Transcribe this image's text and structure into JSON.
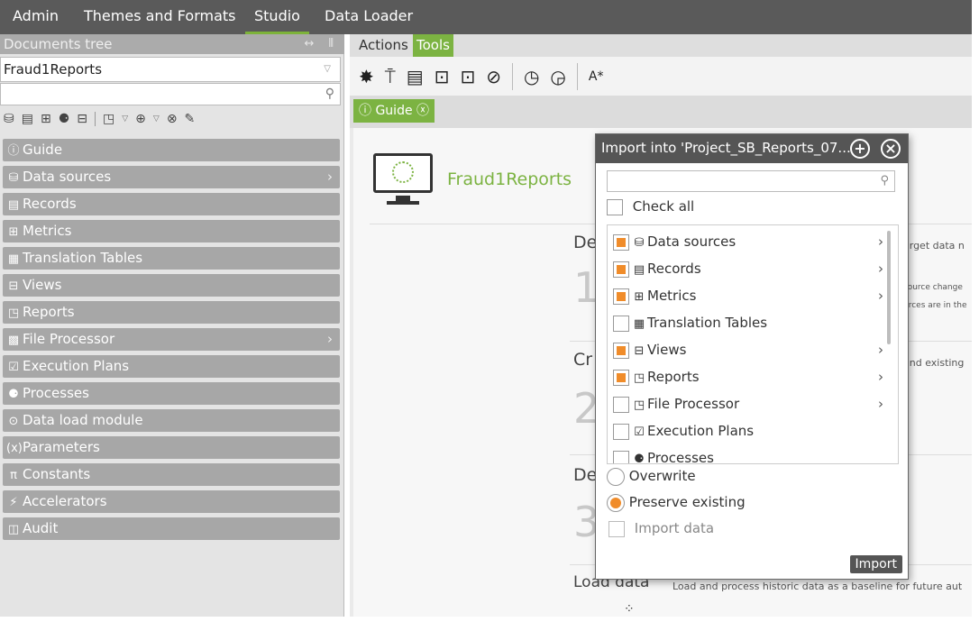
{
  "topbar": {
    "tabs": [
      "Admin",
      "Themes and Formats",
      "Studio",
      "Data Loader"
    ],
    "active": "Studio"
  },
  "left_panel": {
    "title": "Documents tree",
    "title_controls": "↔ ⫴",
    "document_select": "Fraud1Reports",
    "tree_items": [
      {
        "label": "Guide",
        "icon": "info-icon",
        "glyph": "ⓘ"
      },
      {
        "label": "Data sources",
        "icon": "database-icon",
        "glyph": "⛁",
        "has_children": true
      },
      {
        "label": "Records",
        "icon": "records-icon",
        "glyph": "▤"
      },
      {
        "label": "Metrics",
        "icon": "metrics-icon",
        "glyph": "⊞"
      },
      {
        "label": "Translation Tables",
        "icon": "table-icon",
        "glyph": "▦"
      },
      {
        "label": "Views",
        "icon": "views-icon",
        "glyph": "⊟"
      },
      {
        "label": "Reports",
        "icon": "report-icon",
        "glyph": "◳"
      },
      {
        "label": "File Processor",
        "icon": "file-processor-icon",
        "glyph": "▩",
        "has_children": true
      },
      {
        "label": "Execution Plans",
        "icon": "execution-plan-icon",
        "glyph": "☑"
      },
      {
        "label": "Processes",
        "icon": "processes-icon",
        "glyph": "⚈"
      },
      {
        "label": "Data load module",
        "icon": "data-load-icon",
        "glyph": "⊙"
      },
      {
        "label": "Parameters",
        "icon": "parameters-icon",
        "glyph": "(x)"
      },
      {
        "label": "Constants",
        "icon": "pi-icon",
        "glyph": "π"
      },
      {
        "label": "Accelerators",
        "icon": "accelerator-icon",
        "glyph": "⚡"
      },
      {
        "label": "Audit",
        "icon": "audit-icon",
        "glyph": "◫"
      }
    ]
  },
  "right_area": {
    "tabs": [
      "Actions",
      "Tools"
    ],
    "active_tab": "Tools",
    "guide_tab": "Guide",
    "document_title": "Fraud1Reports",
    "steps": [
      {
        "word": "De",
        "num": "1",
        "side": [
          "arget data n",
          "source change",
          "urces are in the"
        ]
      },
      {
        "word": "Cr",
        "num": "2",
        "side": [
          "and existing"
        ]
      },
      {
        "word": "De",
        "num": "3",
        "side": []
      }
    ],
    "load_heading": "Load data",
    "load_text": "Load and process historic data as a baseline for future aut"
  },
  "dialog": {
    "title": "Import into 'Project_SB_Reports_07...",
    "check_all": "Check all",
    "items": [
      {
        "label": "Data sources",
        "icon": "database-icon",
        "glyph": "⛁",
        "state": "partial",
        "chevron": true
      },
      {
        "label": "Records",
        "icon": "records-icon",
        "glyph": "▤",
        "state": "partial",
        "chevron": true
      },
      {
        "label": "Metrics",
        "icon": "metrics-icon",
        "glyph": "⊞",
        "state": "partial",
        "chevron": true
      },
      {
        "label": "Translation Tables",
        "icon": "table-icon",
        "glyph": "▦",
        "state": "empty",
        "chevron": false
      },
      {
        "label": "Views",
        "icon": "views-icon",
        "glyph": "⊟",
        "state": "partial",
        "chevron": true
      },
      {
        "label": "Reports",
        "icon": "report-icon",
        "glyph": "◳",
        "state": "partial",
        "chevron": true
      },
      {
        "label": "File Processor",
        "icon": "file-processor-icon",
        "glyph": "◳",
        "state": "empty",
        "chevron": true
      },
      {
        "label": "Execution Plans",
        "icon": "execution-plan-icon",
        "glyph": "☑",
        "state": "empty",
        "chevron": false
      },
      {
        "label": "Processes",
        "icon": "processes-icon",
        "glyph": "⚈",
        "state": "empty",
        "chevron": false
      }
    ],
    "overwrite": "Overwrite",
    "preserve": "Preserve existing",
    "selected_option": "Preserve existing",
    "import_data": "Import data",
    "import_button": "Import"
  }
}
